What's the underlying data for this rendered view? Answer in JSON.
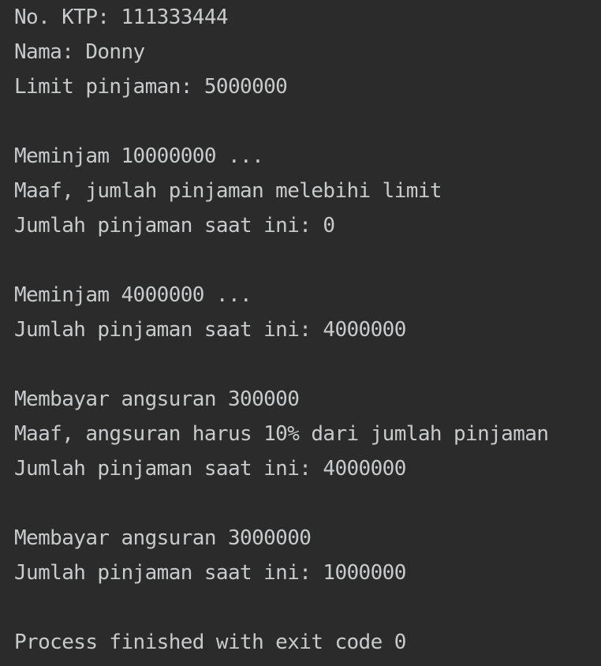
{
  "console": {
    "lines": [
      "No. KTP: 111333444",
      "Nama: Donny",
      "Limit pinjaman: 5000000",
      "",
      "Meminjam 10000000 ...",
      "Maaf, jumlah pinjaman melebihi limit",
      "Jumlah pinjaman saat ini: 0",
      "",
      "Meminjam 4000000 ...",
      "Jumlah pinjaman saat ini: 4000000",
      "",
      "Membayar angsuran 300000",
      "Maaf, angsuran harus 10% dari jumlah pinjaman",
      "Jumlah pinjaman saat ini: 4000000",
      "",
      "Membayar angsuran 3000000",
      "Jumlah pinjaman saat ini: 1000000",
      "",
      "Process finished with exit code 0"
    ]
  },
  "colors": {
    "background": "#2b2b2b",
    "text": "#c8cacb"
  }
}
